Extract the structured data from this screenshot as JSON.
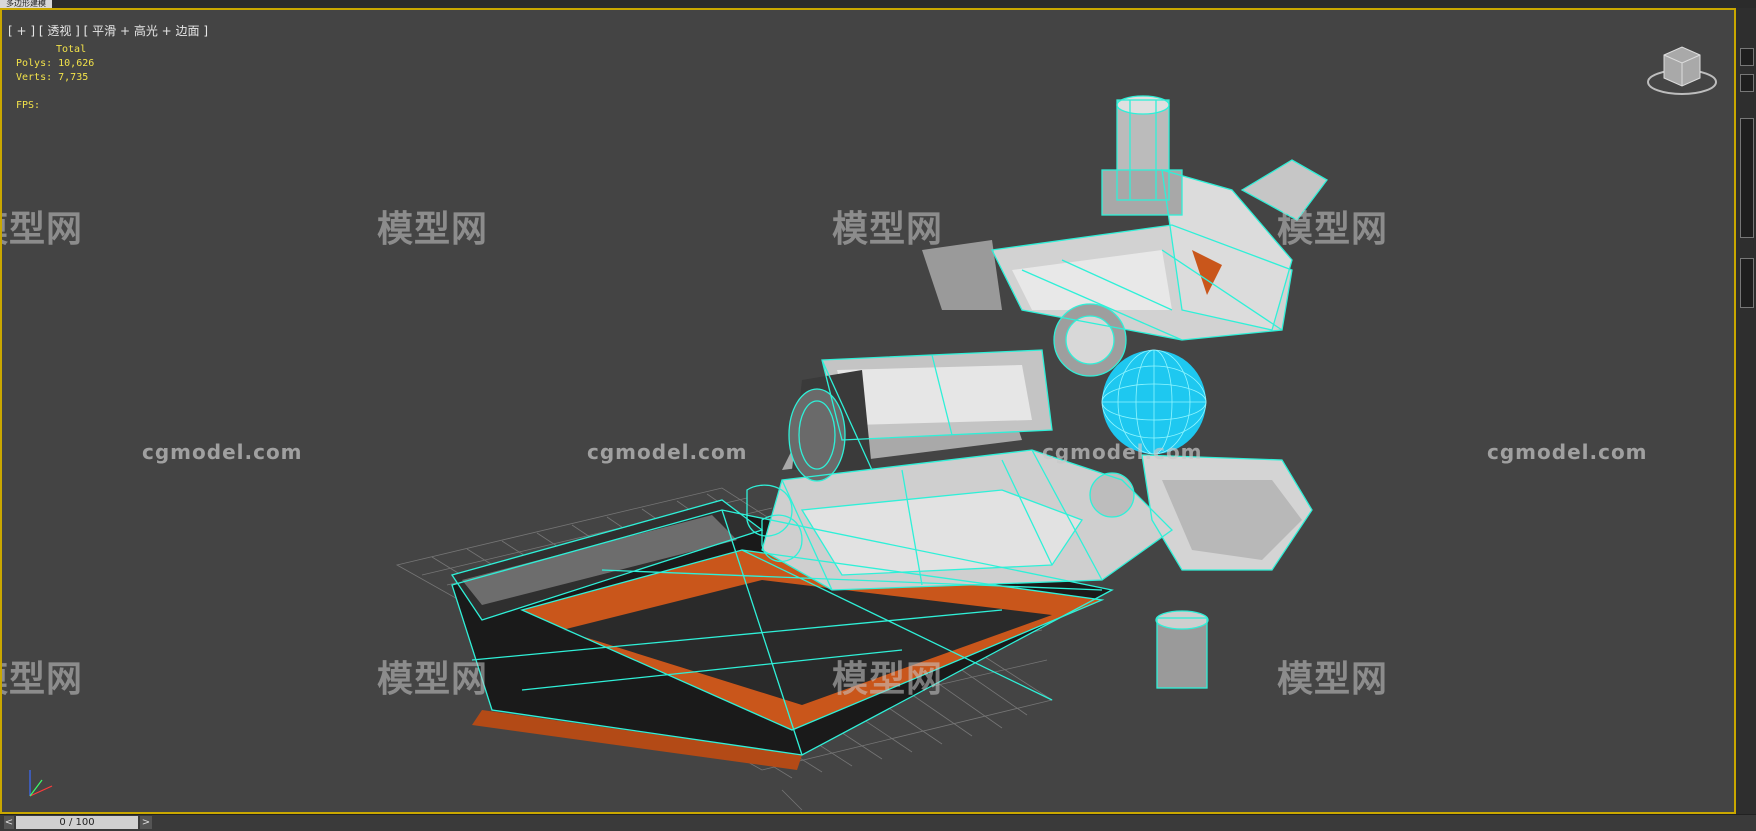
{
  "window": {
    "top_tab_label": "多边形建模",
    "viewport_label": "[ + ] [ 透视 ] [ 平滑 + 高光 + 边面 ]"
  },
  "stats": {
    "total_label": "Total",
    "polys": "Polys: 10,626",
    "verts": "Verts: 7,735",
    "fps": "FPS:"
  },
  "watermarks": {
    "logo_text": "模型网",
    "url_text": "cgmodel.com"
  },
  "timeline": {
    "prev_label": "<",
    "frame_label": "0 / 100",
    "next_label": ">"
  },
  "colors": {
    "viewport_bg": "#444444",
    "viewport_border": "#c9a700",
    "stats_text": "#f2e24a",
    "wireframe": "#2ff0d8",
    "orange_panel": "#c9561b",
    "sphere": "#1ec8f0"
  },
  "icons": {
    "viewcube": "viewcube-icon",
    "axis_gizmo": "axis-gizmo-icon"
  }
}
